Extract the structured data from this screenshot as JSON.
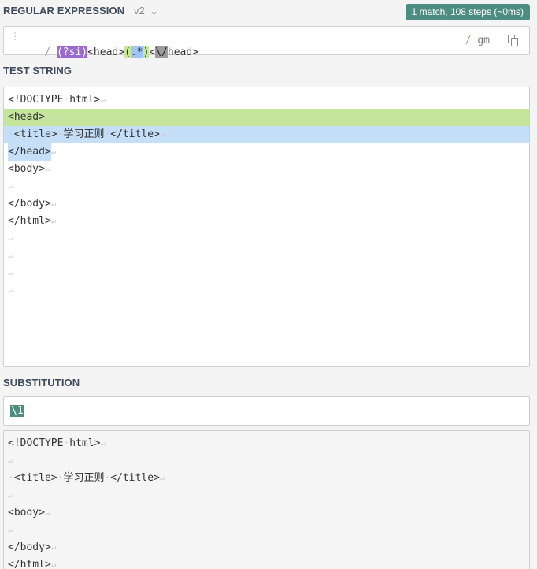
{
  "regex_section": {
    "title": "REGULAR EXPRESSION",
    "version": "v2",
    "match_info": "1 match, 108 steps (~0ms)",
    "delimiter_open": "/",
    "delimiter_close": "/",
    "tokens": [
      {
        "kind": "group-special",
        "text": "(?si)"
      },
      {
        "kind": "text",
        "text": "<head>"
      },
      {
        "kind": "group-open",
        "text": "("
      },
      {
        "kind": "inner",
        "text": ".*"
      },
      {
        "kind": "group-close",
        "text": ")"
      },
      {
        "kind": "text",
        "text": "<"
      },
      {
        "kind": "escape",
        "text": "\\/"
      },
      {
        "kind": "text",
        "text": "head>"
      }
    ],
    "flags": "gm"
  },
  "test_section": {
    "title": "TEST STRING",
    "lines": [
      {
        "segments": [
          {
            "t": "<!DOCTYPE"
          },
          {
            "ws": "·"
          },
          {
            "t": "html>"
          }
        ],
        "nl": true,
        "hl": ""
      },
      {
        "segments": [
          {
            "t": "<head>"
          }
        ],
        "nl": true,
        "hl": "full"
      },
      {
        "segments": [
          {
            "ws": "·"
          },
          {
            "t": "<title>"
          },
          {
            "ws": "·"
          },
          {
            "t": "学习正则"
          },
          {
            "ws": "·"
          },
          {
            "t": "</title>"
          }
        ],
        "nl": true,
        "hl": "grp"
      },
      {
        "segments": [
          {
            "t": "</head>"
          }
        ],
        "nl": true,
        "hl": "end"
      },
      {
        "segments": [
          {
            "t": "<body>"
          }
        ],
        "nl": true,
        "hl": ""
      },
      {
        "segments": [],
        "nl": true,
        "hl": ""
      },
      {
        "segments": [
          {
            "t": "</body>"
          }
        ],
        "nl": true,
        "hl": ""
      },
      {
        "segments": [
          {
            "t": "</html>"
          }
        ],
        "nl": true,
        "hl": ""
      },
      {
        "segments": [],
        "nl": true,
        "hl": ""
      },
      {
        "segments": [],
        "nl": true,
        "hl": ""
      },
      {
        "segments": [],
        "nl": true,
        "hl": ""
      },
      {
        "segments": [],
        "nl": true,
        "hl": ""
      }
    ]
  },
  "substitution_section": {
    "title": "SUBSTITUTION",
    "value": "\\1",
    "result_lines": [
      {
        "segments": [
          {
            "t": "<!DOCTYPE"
          },
          {
            "ws": "·"
          },
          {
            "t": "html>"
          }
        ],
        "nl": true
      },
      {
        "segments": [],
        "nl": true
      },
      {
        "segments": [
          {
            "ws": "·"
          },
          {
            "t": "<title>"
          },
          {
            "ws": "·"
          },
          {
            "t": "学习正则"
          },
          {
            "ws": "·"
          },
          {
            "t": "</title>"
          }
        ],
        "nl": true
      },
      {
        "segments": [],
        "nl": true
      },
      {
        "segments": [
          {
            "t": "<body>"
          }
        ],
        "nl": true
      },
      {
        "segments": [],
        "nl": true
      },
      {
        "segments": [
          {
            "t": "</body>"
          }
        ],
        "nl": true
      },
      {
        "segments": [
          {
            "t": "</html>"
          }
        ],
        "nl": true
      }
    ]
  },
  "glyphs": {
    "newline": "↵",
    "drag_handle": "⋮"
  }
}
